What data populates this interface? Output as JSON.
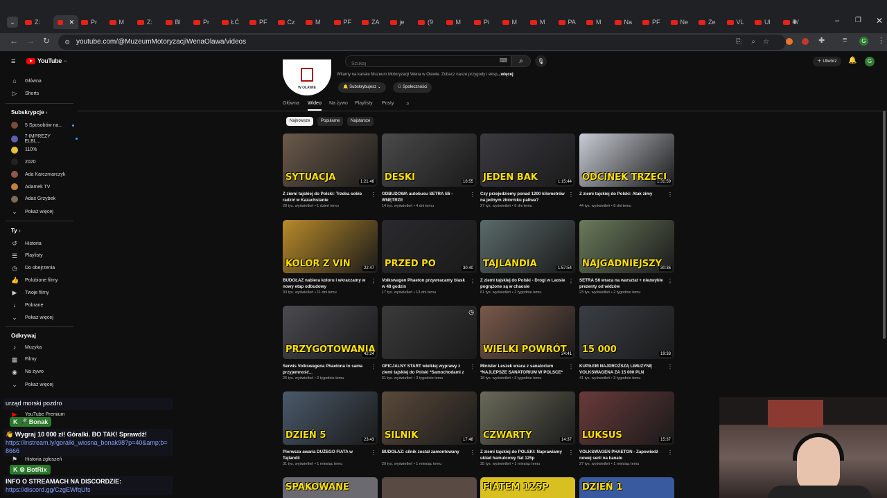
{
  "browser": {
    "tabs": [
      "Z:",
      "",
      "Pr",
      "M",
      "Z:",
      "Bl",
      "Pr",
      "ŁĆ",
      "PF",
      "Cz",
      "M",
      "PF",
      "ZA",
      "je",
      "(9",
      "M",
      "Pi",
      "M",
      "M",
      "PA",
      "M",
      "Na",
      "PF",
      "Ne",
      "Ze",
      "VL",
      "Ul",
      "R/"
    ],
    "url": "youtube.com/@MuzeumMotoryzacjiWenaOlawa/videos",
    "profile_initial": "G"
  },
  "youtube": {
    "logo_text": "YouTube",
    "country_code": "PL",
    "search_placeholder": "Szukaj",
    "create_label": "Utwórz",
    "user_initial": "G"
  },
  "channel": {
    "description": "Witamy na kanale Muzeum Motoryzacji Wena w Oławie. Zobacz nasze przygody i eksp",
    "more_label": "...więcej",
    "logo_text": "W OŁAWIE",
    "subscribe_label": "Subskrybujesz",
    "community_label": "Społeczności",
    "tabs": [
      "Główna",
      "Wideo",
      "Na żywo",
      "Playlisty",
      "Posty"
    ],
    "active_tab": "Wideo",
    "chips": [
      "Najnowsze",
      "Popularne",
      "Najstarsze"
    ]
  },
  "sidebar": {
    "main": [
      {
        "label": "Główna",
        "icon": "home-icon"
      },
      {
        "label": "Shorts",
        "icon": "shorts-icon"
      }
    ],
    "subs_heading": "Subskrypcje",
    "subs": [
      {
        "label": "5 Sposobów na...",
        "color": "#7a4a3a",
        "dot": true
      },
      {
        "label": "7-IMPREZY ELBL...",
        "color": "#5b5fb0",
        "dot": true
      },
      {
        "label": "110%",
        "color": "#e8c03a",
        "dot": false
      },
      {
        "label": "2020",
        "color": "#222222",
        "dot": false
      },
      {
        "label": "Ada Karczmarczyk",
        "color": "#8b5a4a",
        "dot": false
      },
      {
        "label": "Adamek TV",
        "color": "#c08040",
        "dot": false
      },
      {
        "label": "Adaś Grzybek",
        "color": "#7a6a5a",
        "dot": false
      }
    ],
    "show_more": "Pokaż więcej",
    "you_heading": "Ty",
    "you": [
      {
        "label": "Historia",
        "icon": "history-icon"
      },
      {
        "label": "Playlisty",
        "icon": "playlists-icon"
      },
      {
        "label": "Do obejrzenia",
        "icon": "watch-later-icon"
      },
      {
        "label": "Polubione filmy",
        "icon": "like-icon"
      },
      {
        "label": "Twoje filmy",
        "icon": "your-videos-icon"
      },
      {
        "label": "Pobrane",
        "icon": "download-icon"
      }
    ],
    "show_more2": "Pokaż więcej",
    "explore_heading": "Odkrywaj",
    "explore": [
      {
        "label": "Muzyka",
        "icon": "music-icon"
      },
      {
        "label": "Filmy",
        "icon": "movies-icon"
      },
      {
        "label": "Na żywo",
        "icon": "live-icon"
      }
    ],
    "show_more3": "Pokaż więcej",
    "more": [
      {
        "label": "YouTube Premium"
      },
      {
        "label": "Historia zgłoszeń"
      }
    ]
  },
  "videos": [
    {
      "title": "Z ziemi tajskiej do Polski: Trzeba sobie radzić w Kazachstanie",
      "meta": "28 tys. wyświetleń • 1 dzień temu",
      "duration": "1:21:46",
      "caption": "SYTUACJA",
      "bg": "#6b5a4a"
    },
    {
      "title": "ODBUDOWA autobusu SETRA S6 - WNĘTRZE",
      "meta": "14 tys. wyświetleń • 4 dni temu",
      "duration": "16:55",
      "caption": "DESKI",
      "bg": "#4a4a4a"
    },
    {
      "title": "Czy przejedziemy ponad 1200 kilometrów na jednym zbiorniku paliwa? *Volkswagen...",
      "meta": "27 tys. wyświetleń • 6 dni temu",
      "duration": "1:15:44",
      "caption": "JEDEN BAK",
      "bg": "#3a3a40"
    },
    {
      "title": "Z ziemi tajskiej do Polski: Atak zimy",
      "meta": "44 tys. wyświetleń • 8 dni temu",
      "duration": "1:31:59",
      "caption": "ODCINEK TRZECI",
      "bg": "#c8ccd4"
    },
    {
      "title": "BUDOŁAZ nabiera koloru i wkraczamy w nowy etap odbudowy",
      "meta": "33 tys. wyświetleń • 11 dni temu",
      "duration": "22:47",
      "caption": "KOLOR Z VIN",
      "bg": "#b88a2a"
    },
    {
      "title": "Volkswagen Phaeton przywracamy blask w 48 godzin",
      "meta": "17 tys. wyświetleń • 13 dni temu",
      "duration": "30:40",
      "caption": "PRZED   PO",
      "bg": "#2a2a2e"
    },
    {
      "title": "Z ziemi tajskiej do Polski - Drogi w Laosie pogrążone są w chaosie",
      "meta": "61 tys. wyświetleń • 2 tygodnie temu",
      "duration": "1:57:54",
      "caption": "TAJLANDIA",
      "bg": "#5a6a6a"
    },
    {
      "title": "SETRA S6 wraca na warsztat + niezwykłe prezenty od widzów",
      "meta": "23 tys. wyświetleń • 2 tygodnie temu",
      "duration": "30:36",
      "caption": "NAJGADNIEJSZY",
      "bg": "#6a7a5a"
    },
    {
      "title": "Serwis Volkswagena Phaetona to sama przyjemność...",
      "meta": "26 tys. wyświetleń • 2 tygodnie temu",
      "duration": "42:24",
      "caption": "PRZYGOTOWANIA",
      "bg": "#4a4a50"
    },
    {
      "title": "OFICJALNY START wielkiej wyprawy z ziemi tajskiej do Polski *Samochodami z PRL*",
      "meta": "61 tys. wyświetleń • 3 tygodnie temu",
      "duration": "",
      "caption": "",
      "bg": "#3a3a3a"
    },
    {
      "title": "Minister Leszek wraca z sanatorium *NAJLEPSZE SANATORIUM W POLSCE*",
      "meta": "18 tys. wyświetleń • 3 tygodnie temu",
      "duration": "24:41",
      "caption": "WIELKI POWRÓT",
      "bg": "#7a5a4a"
    },
    {
      "title": "KUPIŁEM NAJDROŻSZĄ LIMUZYNĘ VOLKSWAGENA ZA 15 000 PLN",
      "meta": "41 tys. wyświetleń • 3 tygodnie temu",
      "duration": "19:38",
      "caption": "15 000",
      "bg": "#3a3e44"
    },
    {
      "title": "Pierwsza awaria DUŻEGO FIATA w Tajlandii",
      "meta": "31 tys. wyświetleń • 1 miesiąc temu",
      "duration": "23:43",
      "caption": "DZIEŃ 5",
      "bg": "#4a5a6a"
    },
    {
      "title": "BUDOŁAZ: silnik został zamontowany",
      "meta": "29 tys. wyświetleń • 1 miesiąc temu",
      "duration": "17:48",
      "caption": "SILNIK",
      "bg": "#5a4a3a"
    },
    {
      "title": "Z ziemi tajskiej do POLSKI: Naprawiamy układ hamulcowy fiat 125p",
      "meta": "35 tys. wyświetleń • 1 miesiąc temu",
      "duration": "14:37",
      "caption": "CZWARTY",
      "bg": "#6a6a5a"
    },
    {
      "title": "VOLKSWAGEN PHAETON - Zapowiedź nowej serii na kanale",
      "meta": "27 tys. wyświetleń • 1 miesiąc temu",
      "duration": "15:37",
      "caption": "LUKSUS",
      "bg": "#6a3a3a"
    }
  ],
  "partial_row": [
    "SPAKOWANE",
    "",
    "FIATEM 125P",
    "DZIEŃ 1"
  ],
  "overlay": {
    "chat1": "urząd morski pozdro",
    "user1": "Bonak",
    "msg1": "Wygraj 10 000 zł! Góralki. BO TAK! Sprawdź!",
    "link1": "https://instream.ly/goralki_wiosna_bonak98?p=40&amp;b=8666",
    "user2": "BotRix",
    "msg2": "INFO O STREAMACH NA DISCORDZIE:",
    "link2": "https://discord.gg/CzgEWfqUfs"
  }
}
